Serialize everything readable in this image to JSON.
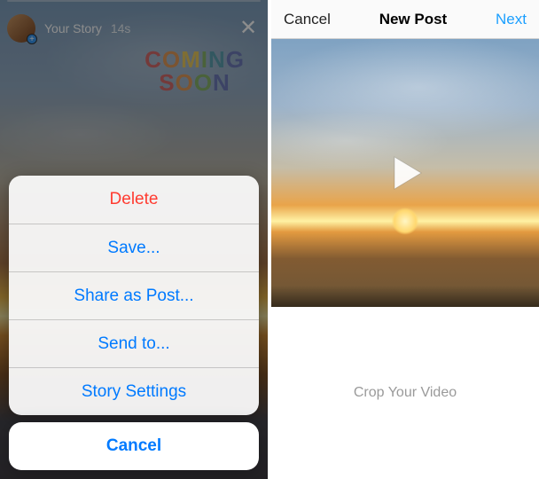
{
  "left": {
    "story_owner": "Your Story",
    "story_time": "14s",
    "sticker_line1_chars": [
      {
        "t": "C",
        "c": "#d46b6b"
      },
      {
        "t": "O",
        "c": "#e0995a"
      },
      {
        "t": "M",
        "c": "#e7c85f"
      },
      {
        "t": "I",
        "c": "#88b26b"
      },
      {
        "t": "N",
        "c": "#5b9fb0"
      },
      {
        "t": "G",
        "c": "#6d7ab8"
      }
    ],
    "sticker_line2_chars": [
      {
        "t": "S",
        "c": "#d46b6b"
      },
      {
        "t": "O",
        "c": "#e0995a"
      },
      {
        "t": "O",
        "c": "#88b26b"
      },
      {
        "t": "N",
        "c": "#6d7ab8"
      }
    ],
    "action_sheet": {
      "items": [
        {
          "label": "Delete",
          "destructive": true
        },
        {
          "label": "Save..."
        },
        {
          "label": "Share as Post..."
        },
        {
          "label": "Send to..."
        },
        {
          "label": "Story Settings"
        }
      ],
      "cancel_label": "Cancel"
    }
  },
  "right": {
    "header": {
      "cancel": "Cancel",
      "title": "New Post",
      "next": "Next"
    },
    "crop_label": "Crop Your Video"
  }
}
